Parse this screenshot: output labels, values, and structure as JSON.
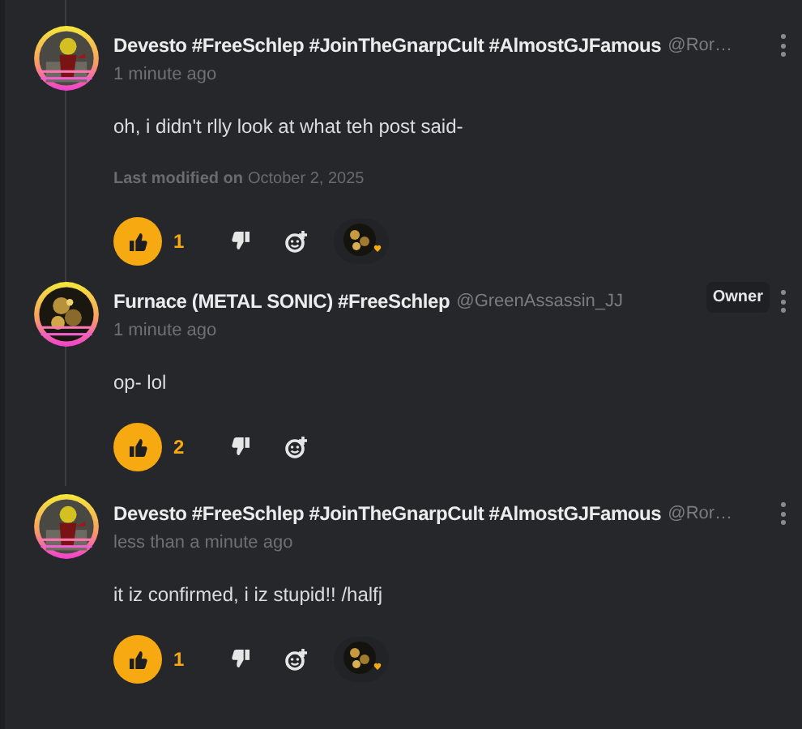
{
  "comments": [
    {
      "name": "Devesto #FreeSchlep #JoinTheGnarpCult #AlmostGJFamous",
      "handle": "@Ror…",
      "time": "1 minute ago",
      "body": "oh, i didn't rlly look at what teh post said-",
      "modified": {
        "label": "Last modified on",
        "date": "October 2, 2025"
      },
      "likes": "1",
      "liked": true,
      "reactor": true
    },
    {
      "name": "Furnace (METAL SONIC) #FreeSchlep",
      "handle": "@GreenAssassin_JJ",
      "badge": "Owner",
      "time": "1 minute ago",
      "body": "op- lol",
      "likes": "2",
      "liked": true,
      "reactor": false
    },
    {
      "name": "Devesto #FreeSchlep #JoinTheGnarpCult #AlmostGJFamous",
      "handle": "@Ror…",
      "time": "less than a minute ago",
      "body": "it iz confirmed, i iz stupid!! /halfj",
      "likes": "1",
      "liked": true,
      "reactor": true
    }
  ]
}
